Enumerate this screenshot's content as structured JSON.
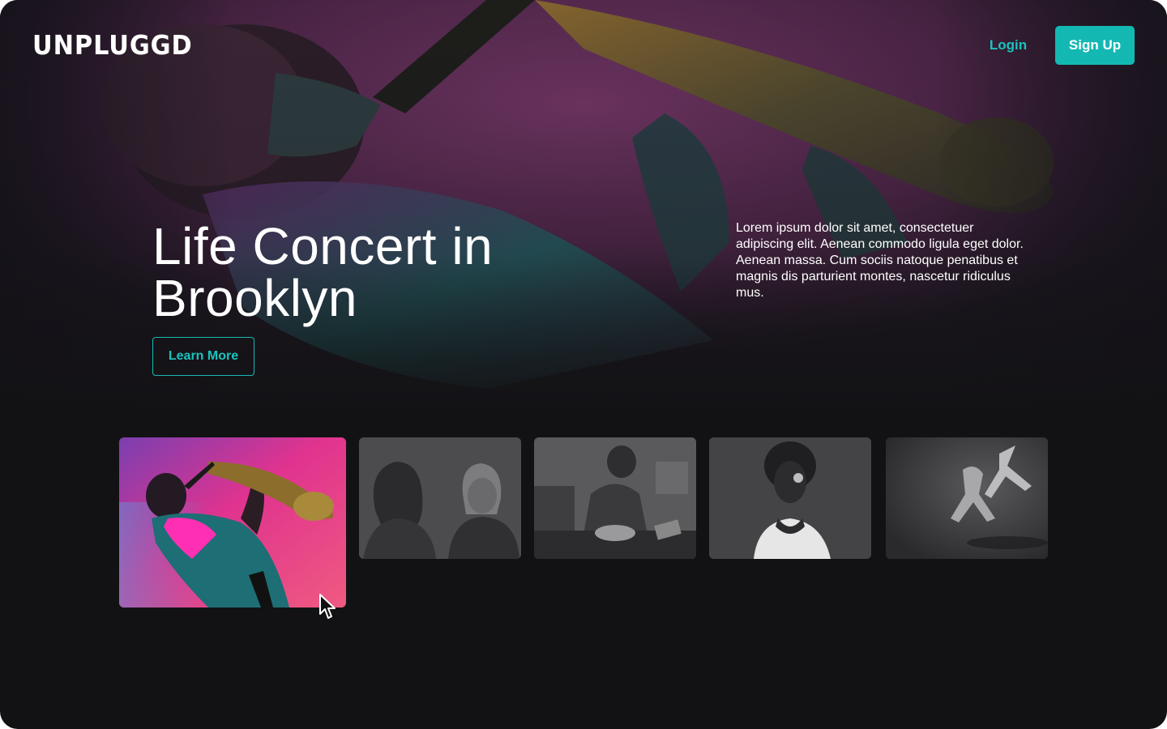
{
  "app": {
    "logo": "UNPLUGGD"
  },
  "nav": {
    "login_label": "Login",
    "signup_label": "Sign Up"
  },
  "hero": {
    "title_line1": "Life Concert in",
    "title_line2": "Brooklyn",
    "cta_label": "Learn More",
    "description": "Lorem ipsum dolor sit amet, consectetuer adipiscing elit. Aenean commodo ligula eget dolor. Aenean massa. Cum sociis natoque penatibus et magnis dis parturient montes, nascetur ridiculus mus."
  },
  "gallery": {
    "items": [
      {
        "subject": "saxophone-player",
        "state": "selected"
      },
      {
        "subject": "two-women",
        "state": "inactive"
      },
      {
        "subject": "woman-baking",
        "state": "inactive"
      },
      {
        "subject": "woman-portrait",
        "state": "inactive"
      },
      {
        "subject": "dancers",
        "state": "inactive"
      }
    ]
  },
  "colors": {
    "accent": "#14b8b2",
    "accent_text": "#19c3bd",
    "background": "#121214",
    "hero_magenta": "#6b2f5d"
  },
  "icons": {
    "cursor": "mouse-pointer-icon"
  }
}
